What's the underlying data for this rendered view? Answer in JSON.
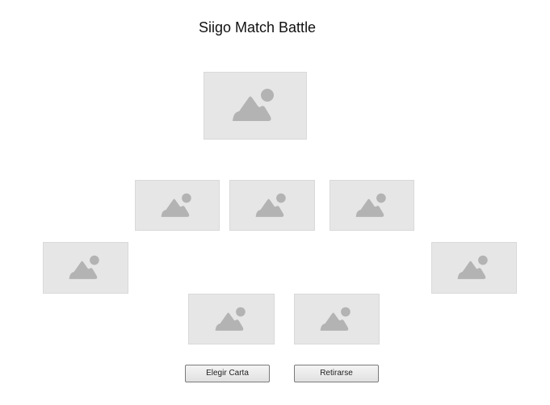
{
  "header": {
    "title": "Siigo Match Battle"
  },
  "icons": {
    "card_image": "image-placeholder-icon"
  },
  "colors": {
    "card_background": "#e6e6e6",
    "placeholder_icon": "#b3b3b3"
  },
  "actions": {
    "choose_card_label": "Elegir Carta",
    "withdraw_label": "Retirarse"
  }
}
